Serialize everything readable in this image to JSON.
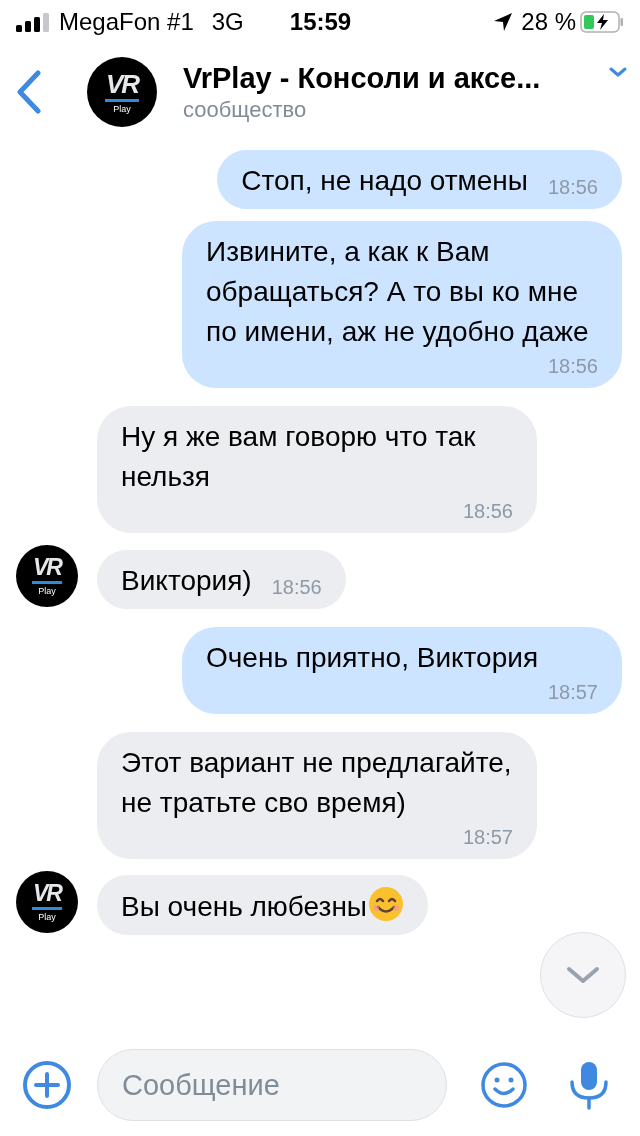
{
  "status_bar": {
    "carrier": "MegaFon #1",
    "network": "3G",
    "time": "15:59",
    "battery": "28 %"
  },
  "header": {
    "title": "VrPlay - Консоли и аксе...",
    "subtitle": "сообщество",
    "avatar": {
      "logo": "VR",
      "caption": "Play"
    }
  },
  "messages": [
    {
      "kind": "outgoing",
      "text": "Стоп, не надо отмены",
      "time": "18:56"
    },
    {
      "kind": "outgoing",
      "text": "Извините, а как к Вам обращаться? А то вы ко мне по имени, аж не удобно даже",
      "time": "18:56"
    },
    {
      "kind": "incoming",
      "text": "Ну я же вам говорю что так нельзя",
      "time": "18:56"
    },
    {
      "kind": "incoming",
      "text": "Виктория)",
      "time": "18:56",
      "avatar": {
        "logo": "VR",
        "caption": "Play"
      }
    },
    {
      "kind": "outgoing",
      "text": "Очень приятно, Виктория",
      "time": "18:57"
    },
    {
      "kind": "incoming",
      "text": "Этот вариант не предлагайте, не тратьте сво время)",
      "time": "18:57"
    },
    {
      "kind": "incoming",
      "text": "Вы очень любезны",
      "emoji": {
        "kind": "smile"
      },
      "avatar": {
        "logo": "VR",
        "caption": "Play"
      }
    }
  ],
  "composer": {
    "placeholder": "Сообщение"
  }
}
